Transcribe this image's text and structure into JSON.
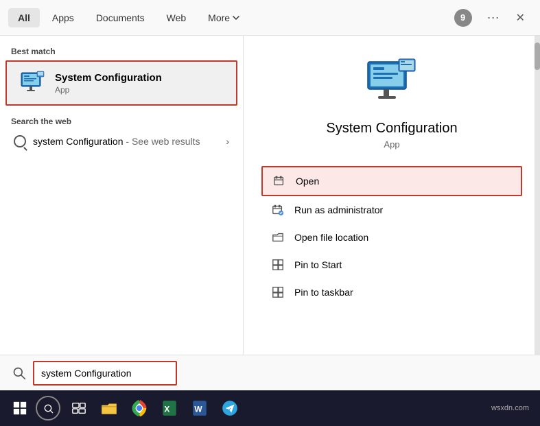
{
  "tabs": {
    "items": [
      {
        "label": "All",
        "active": true
      },
      {
        "label": "Apps",
        "active": false
      },
      {
        "label": "Documents",
        "active": false
      },
      {
        "label": "Web",
        "active": false
      },
      {
        "label": "More",
        "active": false,
        "has_arrow": true
      }
    ],
    "badge_count": "9"
  },
  "left_panel": {
    "best_match_label": "Best match",
    "best_match_title": "System Configuration",
    "best_match_sub": "App",
    "search_web_label": "Search the web",
    "search_web_query": "system Configuration",
    "search_web_suffix": " - See web results"
  },
  "right_panel": {
    "app_title": "System Configuration",
    "app_sub": "App",
    "actions": [
      {
        "label": "Open",
        "highlighted": true,
        "icon": "open-icon"
      },
      {
        "label": "Run as administrator",
        "highlighted": false,
        "icon": "admin-icon"
      },
      {
        "label": "Open file location",
        "highlighted": false,
        "icon": "folder-icon"
      },
      {
        "label": "Pin to Start",
        "highlighted": false,
        "icon": "pin-icon"
      },
      {
        "label": "Pin to taskbar",
        "highlighted": false,
        "icon": "pin-icon2"
      }
    ]
  },
  "bottom_bar": {
    "search_text": "system Configuration"
  },
  "taskbar": {
    "watermark": "wsxdn.com"
  }
}
